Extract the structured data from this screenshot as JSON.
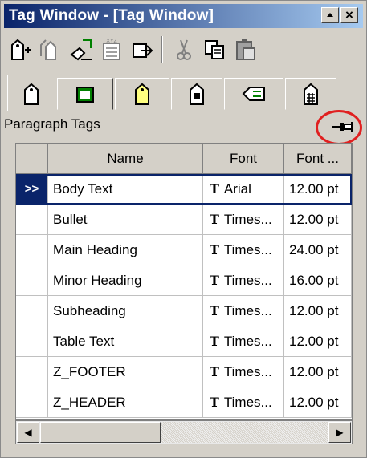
{
  "window": {
    "title": "Tag Window - [Tag Window]",
    "title_bar_colors": {
      "start": "#0a246a",
      "end": "#a6caf0"
    },
    "minimize_icon": "minimize-icon",
    "close_glyph": "×"
  },
  "toolbar": {
    "buttons": [
      {
        "name": "new-tag-icon"
      },
      {
        "name": "copy-tag-icon"
      },
      {
        "name": "edit-tag-icon"
      },
      {
        "name": "xyz-tag-icon",
        "text": "XYZ"
      },
      {
        "name": "apply-tag-icon"
      },
      {
        "name": "cut-icon"
      },
      {
        "name": "copy-icon"
      },
      {
        "name": "paste-icon"
      }
    ]
  },
  "tabs": [
    {
      "name": "paragraph-tags-tab",
      "active": true
    },
    {
      "name": "character-tags-tab"
    },
    {
      "name": "list-tags-tab"
    },
    {
      "name": "frame-tags-tab"
    },
    {
      "name": "table-tags-tab"
    },
    {
      "name": "cell-tags-tab"
    }
  ],
  "panel": {
    "label": "Paragraph Tags",
    "pin_icon": "pushpin-icon",
    "highlight_color": "#e02020"
  },
  "table": {
    "columns": [
      "Name",
      "Font",
      "Font ..."
    ],
    "current_marker": ">>",
    "rows": [
      {
        "name": "Body Text",
        "font": "Arial",
        "size": "12.00 pt",
        "current": true
      },
      {
        "name": "Bullet",
        "font": "Times...",
        "size": "12.00 pt"
      },
      {
        "name": "Main Heading",
        "font": "Times...",
        "size": "24.00 pt"
      },
      {
        "name": "Minor Heading",
        "font": "Times...",
        "size": "16.00 pt"
      },
      {
        "name": "Subheading",
        "font": "Times...",
        "size": "12.00 pt"
      },
      {
        "name": "Table Text",
        "font": "Times...",
        "size": "12.00 pt"
      },
      {
        "name": "Z_FOOTER",
        "font": "Times...",
        "size": "12.00 pt"
      },
      {
        "name": "Z_HEADER",
        "font": "Times...",
        "size": "12.00 pt"
      }
    ],
    "font_icon_glyph": "T"
  },
  "scrollbar": {
    "left_arrow": "◀",
    "right_arrow": "▶"
  }
}
